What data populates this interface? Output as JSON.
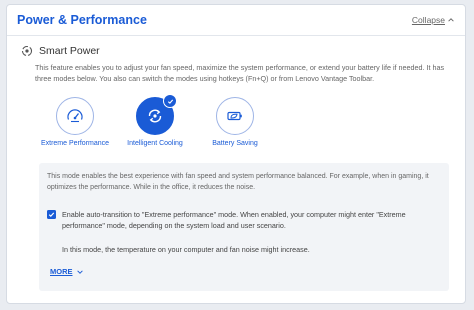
{
  "header": {
    "title": "Power & Performance",
    "collapse_label": "Collapse",
    "collapse_icon": "chevron-up-icon"
  },
  "smart_power": {
    "title": "Smart Power",
    "icon": "power-cycle-icon",
    "description": "This feature enables you to adjust your fan speed, maximize the system performance, or extend your battery life if needed. It has three modes below. You also can switch the modes using hotkeys (Fn+Q) or from Lenovo Vantage Toolbar.",
    "modes": [
      {
        "label": "Extreme Performance",
        "icon": "speedometer-icon",
        "selected": false
      },
      {
        "label": "Intelligent Cooling",
        "icon": "cooling-cycle-icon",
        "selected": true
      },
      {
        "label": "Battery Saving",
        "icon": "battery-leaf-icon",
        "selected": false
      }
    ]
  },
  "info": {
    "description": "This mode enables the best experience with fan speed and system performance balanced. For example, when in gaming, it optimizes the performance. While in the office, it reduces the noise.",
    "auto_transition": {
      "checked": true,
      "label": "Enable auto-transition to \"Extreme performance\" mode. When enabled, your computer might enter \"Extreme performance\" mode, depending on the system load and user scenario."
    },
    "note": "In this mode, the temperature on your computer and fan noise might increase.",
    "more_label": "MORE"
  },
  "colors": {
    "accent": "#1a5bd6",
    "panel_bg": "#ffffff",
    "info_bg": "#f2f4f7",
    "page_bg": "#e9ecf1"
  }
}
